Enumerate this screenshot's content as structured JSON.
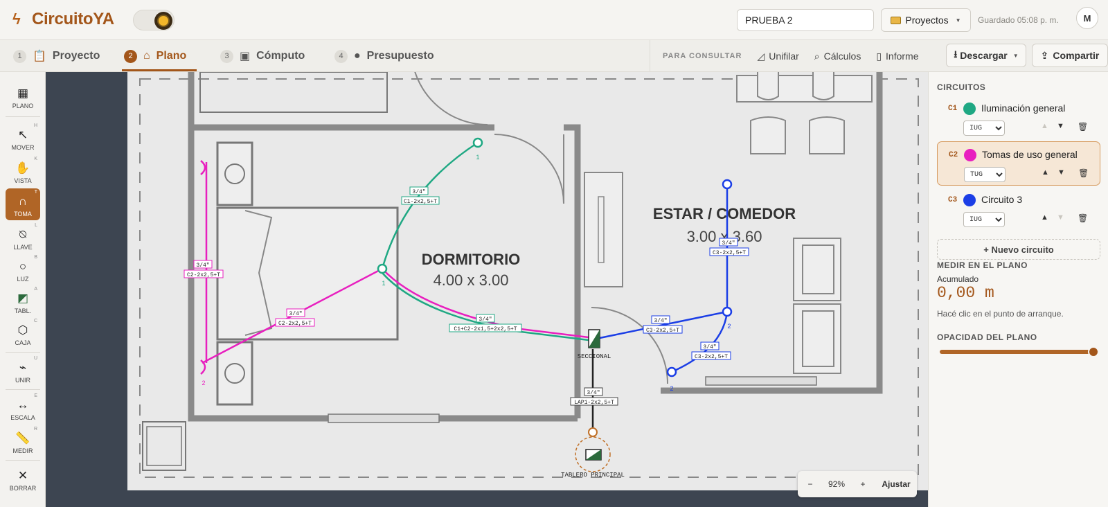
{
  "app": {
    "name": "CircuitoYA",
    "project_name": "PRUEBA 2",
    "projects_label": "Proyectos",
    "saved_text": "Guardado 05:08 p. m.",
    "user_initial": "M"
  },
  "steps": [
    {
      "num": "1",
      "label": "Proyecto",
      "icon": "clipboard-icon"
    },
    {
      "num": "2",
      "label": "Plano",
      "icon": "house-icon"
    },
    {
      "num": "3",
      "label": "Cómputo",
      "icon": "box-icon"
    },
    {
      "num": "4",
      "label": "Presupuesto",
      "icon": "money-bag-icon"
    }
  ],
  "consult": {
    "label": "PARA CONSULTAR",
    "items": [
      "Unifilar",
      "Cálculos",
      "Informe"
    ]
  },
  "actions": {
    "download": "Descargar",
    "share": "Compartir"
  },
  "tools": [
    {
      "label": "PLANO",
      "key": "",
      "icon": "map-icon"
    },
    {
      "label": "MOVER",
      "key": "H",
      "icon": "arrow-icon"
    },
    {
      "label": "VISTA",
      "key": "K",
      "icon": "hand-icon"
    },
    {
      "label": "TOMA",
      "key": "T",
      "icon": "socket-icon"
    },
    {
      "label": "LLAVE",
      "key": "L",
      "icon": "switch-icon"
    },
    {
      "label": "LUZ",
      "key": "B",
      "icon": "light-icon"
    },
    {
      "label": "TABL.",
      "key": "A",
      "icon": "panel-icon"
    },
    {
      "label": "CAJA",
      "key": "C",
      "icon": "box-hex-icon"
    },
    {
      "label": "UNIR",
      "key": "U",
      "icon": "join-icon"
    },
    {
      "label": "ESCALA",
      "key": "E",
      "icon": "scale-icon"
    },
    {
      "label": "MEDIR",
      "key": "R",
      "icon": "ruler-icon"
    },
    {
      "label": "BORRAR",
      "key": "",
      "icon": "close-icon"
    }
  ],
  "plan": {
    "room1_name": "DORMITORIO",
    "room1_size": "4.00 x 3.00",
    "room2_name": "ESTAR / COMEDOR",
    "room2_size": "3.00 x 3.60",
    "seccional": "SECCIONAL",
    "tablero": "TABLERO PRINCIPAL",
    "pipe": "3/4\"",
    "label_c1": "C1-2x2,5+T",
    "label_c2": "C2-2x2,5+T",
    "label_c1c2": "C1+C2-2x1,5+2x2,5+T",
    "label_c3": "C3-2x2,5+T",
    "label_lap": "LAP1-2x2,5+T",
    "n1": "1",
    "n2": "2"
  },
  "circuits_title": "CIRCUITOS",
  "circuits": [
    {
      "code": "C1",
      "name": "Iluminación general",
      "color": "#1fa883",
      "type": "IUG"
    },
    {
      "code": "C2",
      "name": "Tomas de uso general",
      "color": "#e81fbf",
      "type": "TUG"
    },
    {
      "code": "C3",
      "name": "Circuito 3",
      "color": "#1b3ee6",
      "type": "IUG"
    }
  ],
  "circuit_types": [
    "IUG",
    "TUG"
  ],
  "new_circuit": "+ Nuevo circuito",
  "measure": {
    "title": "MEDIR EN EL PLANO",
    "acc_label": "Acumulado",
    "acc_value": "0,00 m",
    "hint": "Hacé clic en el punto de arranque."
  },
  "opacity": {
    "title": "OPACIDAD DEL PLANO",
    "value": 1.0
  },
  "zoom": {
    "minus": "−",
    "value": "92%",
    "plus": "+",
    "fit": "Ajustar"
  }
}
